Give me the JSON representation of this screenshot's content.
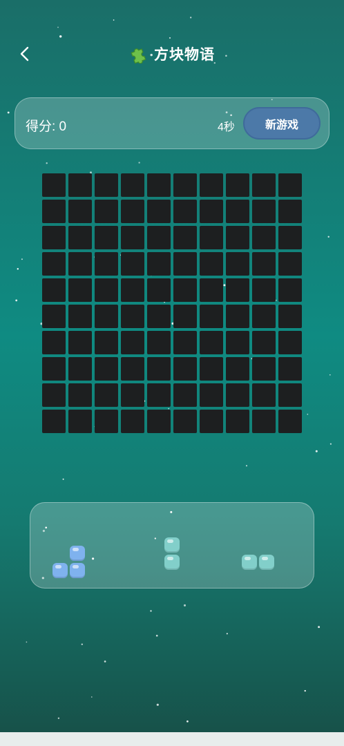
{
  "header": {
    "title": "方块物语",
    "title_icon": "puzzle-piece-icon",
    "back_icon": "chevron-left-icon"
  },
  "score_panel": {
    "score_label": "得分: 0",
    "score_value": 0,
    "timer_label": "4秒",
    "new_game_label": "新游戏"
  },
  "board": {
    "rows": 10,
    "cols": 10,
    "filled_cells": []
  },
  "pieces": [
    {
      "name": "piece-l-blue",
      "color": "#7fb2ee",
      "cells": [
        [
          0,
          1
        ],
        [
          1,
          0
        ],
        [
          1,
          1
        ]
      ]
    },
    {
      "name": "piece-vertical-teal",
      "color": "#82cfca",
      "cells": [
        [
          0,
          0
        ],
        [
          1,
          0
        ]
      ]
    },
    {
      "name": "piece-horizontal-teal",
      "color": "#82cfca",
      "cells": [
        [
          0,
          0
        ],
        [
          0,
          1
        ]
      ]
    }
  ],
  "colors": {
    "bg_top": "#1a6e68",
    "bg_mid": "#0f8b82",
    "cell_empty": "#1d1f20",
    "button_bg": "#4c79a8",
    "piece_blue": "#7fb2ee",
    "piece_teal": "#82cfca"
  }
}
